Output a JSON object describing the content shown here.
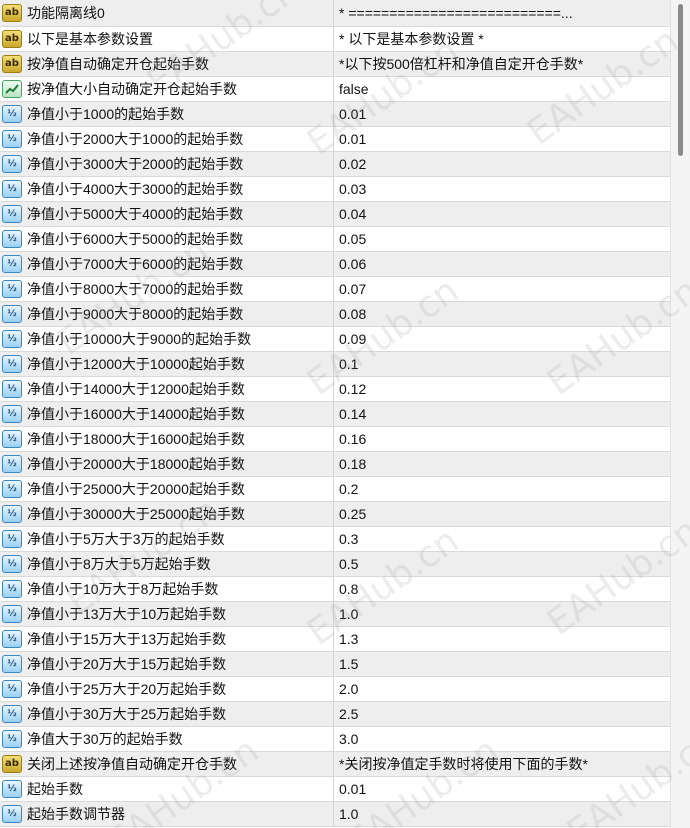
{
  "watermark": "EAHub.cn",
  "params": [
    {
      "type": "ab",
      "name": "功能隔离线0",
      "value": "* ==========================..."
    },
    {
      "type": "ab",
      "name": "以下是基本参数设置",
      "value": "* 以下是基本参数设置 *"
    },
    {
      "type": "ab",
      "name": "按净值自动确定开仓起始手数",
      "value": "*以下按500倍杠杆和净值自定开仓手数*"
    },
    {
      "type": "bool",
      "name": "按净值大小自动确定开仓起始手数",
      "value": "false"
    },
    {
      "type": "v2",
      "name": "净值小于1000的起始手数",
      "value": "0.01"
    },
    {
      "type": "v2",
      "name": "净值小于2000大于1000的起始手数",
      "value": "0.01"
    },
    {
      "type": "v2",
      "name": "净值小于3000大于2000的起始手数",
      "value": "0.02"
    },
    {
      "type": "v2",
      "name": "净值小于4000大于3000的起始手数",
      "value": "0.03"
    },
    {
      "type": "v2",
      "name": "净值小于5000大于4000的起始手数",
      "value": "0.04"
    },
    {
      "type": "v2",
      "name": "净值小于6000大于5000的起始手数",
      "value": "0.05"
    },
    {
      "type": "v2",
      "name": "净值小于7000大于6000的起始手数",
      "value": "0.06"
    },
    {
      "type": "v2",
      "name": "净值小于8000大于7000的起始手数",
      "value": "0.07"
    },
    {
      "type": "v2",
      "name": "净值小于9000大于8000的起始手数",
      "value": "0.08"
    },
    {
      "type": "v2",
      "name": "净值小于10000大于9000的起始手数",
      "value": "0.09"
    },
    {
      "type": "v2",
      "name": "净值小于12000大于10000起始手数",
      "value": "0.1"
    },
    {
      "type": "v2",
      "name": "净值小于14000大于12000起始手数",
      "value": "0.12"
    },
    {
      "type": "v2",
      "name": "净值小于16000大于14000起始手数",
      "value": "0.14"
    },
    {
      "type": "v2",
      "name": "净值小于18000大于16000起始手数",
      "value": "0.16"
    },
    {
      "type": "v2",
      "name": "净值小于20000大于18000起始手数",
      "value": "0.18"
    },
    {
      "type": "v2",
      "name": "净值小于25000大于20000起始手数",
      "value": "0.2"
    },
    {
      "type": "v2",
      "name": "净值小于30000大于25000起始手数",
      "value": "0.25"
    },
    {
      "type": "v2",
      "name": "净值小于5万大于3万的起始手数",
      "value": "0.3"
    },
    {
      "type": "v2",
      "name": "净值小于8万大于5万起始手数",
      "value": "0.5"
    },
    {
      "type": "v2",
      "name": "净值小于10万大于8万起始手数",
      "value": "0.8"
    },
    {
      "type": "v2",
      "name": "净值小于13万大于10万起始手数",
      "value": "1.0"
    },
    {
      "type": "v2",
      "name": "净值小于15万大于13万起始手数",
      "value": "1.3"
    },
    {
      "type": "v2",
      "name": "净值小于20万大于15万起始手数",
      "value": "1.5"
    },
    {
      "type": "v2",
      "name": "净值小于25万大于20万起始手数",
      "value": "2.0"
    },
    {
      "type": "v2",
      "name": "净值小于30万大于25万起始手数",
      "value": "2.5"
    },
    {
      "type": "v2",
      "name": "净值大于30万的起始手数",
      "value": "3.0"
    },
    {
      "type": "ab",
      "name": "关闭上述按净值自动确定开仓手数",
      "value": "*关闭按净值定手数时将使用下面的手数*"
    },
    {
      "type": "v2",
      "name": "起始手数",
      "value": "0.01"
    },
    {
      "type": "v2",
      "name": "起始手数调节器",
      "value": "1.0"
    }
  ]
}
